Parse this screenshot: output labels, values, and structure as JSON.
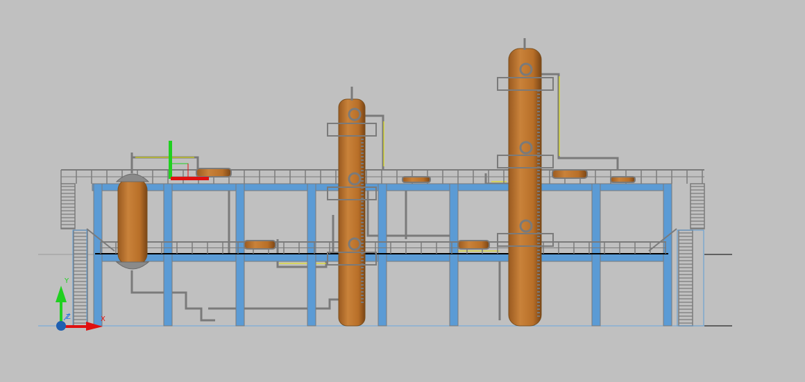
{
  "viewport": {
    "background": "#c0c0c0",
    "colors": {
      "steel": "#5b9bd5",
      "vessel": "#c07830",
      "pipe": "#7a7a7a",
      "valve_mark": "#e8e800",
      "ground": "#6aa8e0"
    }
  },
  "ucs_icon": {
    "x_label": "X",
    "y_label": "Y",
    "z_label": "Z",
    "x_color": "#e01010",
    "y_color": "#20d020",
    "z_color": "#2070e0"
  },
  "gizmo": {
    "x_color": "#e01010",
    "y_color": "#20d020"
  }
}
